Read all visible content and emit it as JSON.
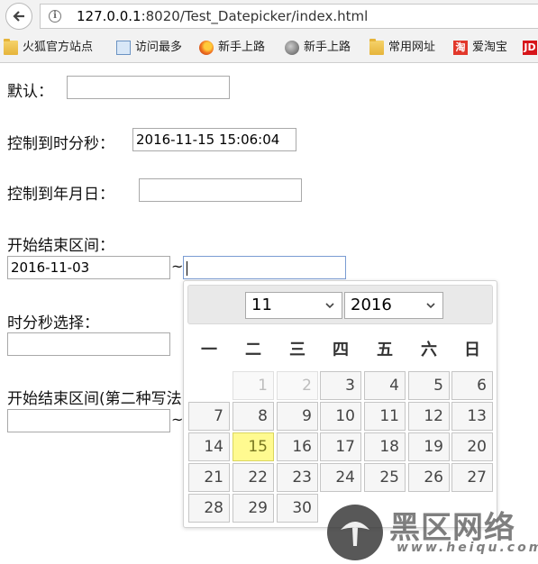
{
  "browser": {
    "url_host": "127.0.0.1",
    "url_rest": ":8020/Test_Datepicker/index.html",
    "bookmarks": [
      {
        "label": "火狐官方站点",
        "icon": "folder-icon"
      },
      {
        "label": "访问最多",
        "icon": "most-visited-icon"
      },
      {
        "label": "新手上路",
        "icon": "firefox-icon"
      },
      {
        "label": "新手上路",
        "icon": "globe-icon"
      },
      {
        "label": "常用网址",
        "icon": "folder-icon"
      },
      {
        "label": "爱淘宝",
        "icon": "taobao-icon",
        "glyph": "淘"
      },
      {
        "label": "",
        "icon": "jd-icon",
        "glyph": "JD"
      }
    ]
  },
  "form": {
    "default_label": "默认：",
    "default_value": "",
    "hms_label": "控制到时分秒：",
    "hms_value": "2016-11-15 15:06:04",
    "ymd_label": "控制到年月日：",
    "ymd_value": "",
    "range_label": "开始结束区间：",
    "range_start": "2016-11-03",
    "range_sep": "~",
    "range_end": "",
    "time_label": "时分秒选择：",
    "time_value": "",
    "range2_label": "开始结束区间(第二种写法)：",
    "range2_start": "",
    "range2_sep": "~"
  },
  "datepicker": {
    "month": "11",
    "year": "2016",
    "weekdays": [
      "一",
      "二",
      "三",
      "四",
      "五",
      "六",
      "日"
    ],
    "weeks": [
      [
        "",
        "1",
        "2",
        "3",
        "4",
        "5",
        "6"
      ],
      [
        "7",
        "8",
        "9",
        "10",
        "11",
        "12",
        "13"
      ],
      [
        "14",
        "15",
        "16",
        "17",
        "18",
        "19",
        "20"
      ],
      [
        "21",
        "22",
        "23",
        "24",
        "25",
        "26",
        "27"
      ],
      [
        "28",
        "29",
        "30",
        "",
        "",
        "",
        ""
      ]
    ],
    "disabled_days": [
      "1",
      "2"
    ],
    "highlighted_day": "15",
    "highlight_color": "#fffa90"
  },
  "watermark": {
    "title": "黑区网络",
    "url": "www.heiqu.com"
  }
}
